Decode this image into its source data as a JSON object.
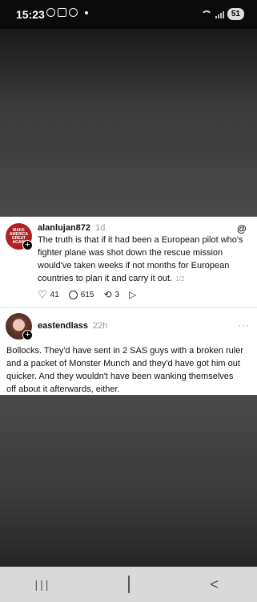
{
  "status_bar": {
    "time": "15:23",
    "battery": "51"
  },
  "post1": {
    "username": "alanlujan872",
    "time": "1d",
    "avatar_text": [
      "MAKE",
      "AMERICA",
      "GREAT",
      "AGAIN"
    ],
    "lines": [
      "The truth is that if it had been a European pilot who's",
      "fighter plane was shot down the rescue mission",
      "would've taken weeks if not months for European",
      "countries to plan it and carry it out."
    ],
    "counter": "1/2",
    "likes": "41",
    "replies": "615",
    "reposts": "3"
  },
  "post2": {
    "username": "eastendlass",
    "time": "22h",
    "lines": [
      "Bollocks. They'd have sent in 2 SAS guys with a broken ruler",
      "and a packet of Monster Munch and they'd have got him out",
      "quicker. And they wouldn't have been wanking themselves",
      "off about it afterwards, either."
    ],
    "more": "···"
  },
  "icons": {
    "heart": "heart-icon",
    "reply": "comment-icon",
    "repost": "repost-icon",
    "share": "share-icon"
  }
}
